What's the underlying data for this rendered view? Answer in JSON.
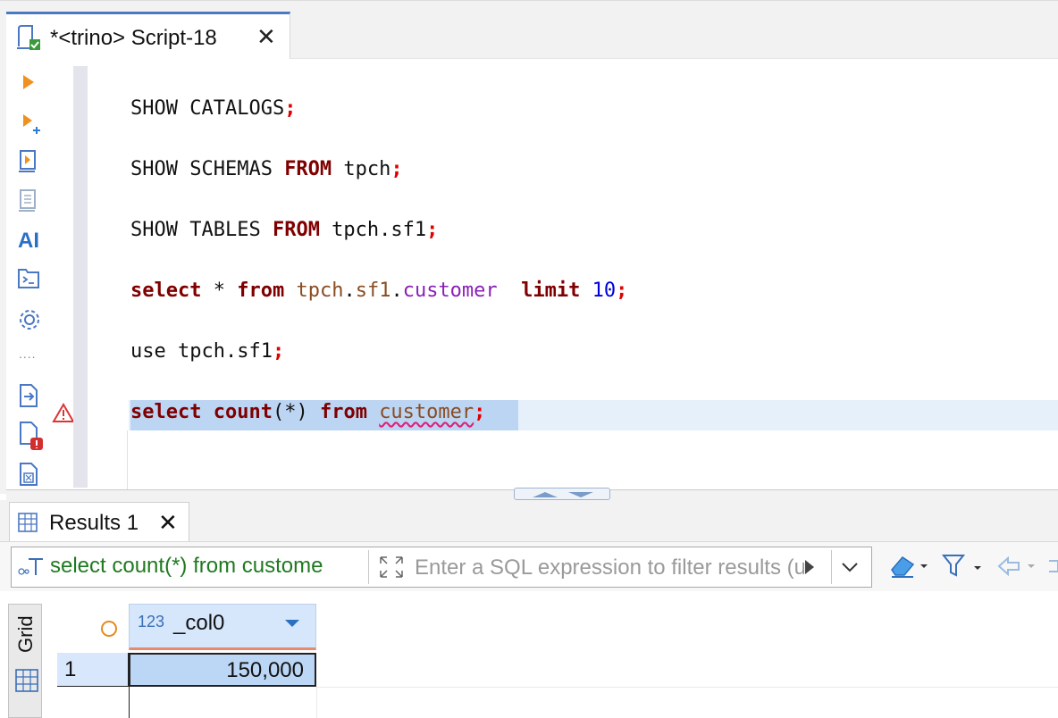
{
  "editor_tab": {
    "title": "*<trino> Script-18",
    "close": "✕"
  },
  "toolbar": {
    "items": [
      "execute-statement",
      "execute-in-new-tab",
      "execute-script",
      "explain-plan",
      "ai-assistant",
      "open-console",
      "settings",
      "more",
      "export",
      "problems",
      "format"
    ],
    "ai_label": "AI",
    "more_label": "...."
  },
  "code_lines": [
    {
      "parts": [
        {
          "t": "SHOW CATALOGS",
          "c": "plain"
        },
        {
          "t": ";",
          "c": "semi"
        }
      ]
    },
    {
      "parts": [
        {
          "t": "SHOW SCHEMAS ",
          "c": "plain"
        },
        {
          "t": "FROM",
          "c": "kw"
        },
        {
          "t": " tpch",
          "c": "plain"
        },
        {
          "t": ";",
          "c": "semi"
        }
      ]
    },
    {
      "parts": [
        {
          "t": "SHOW TABLES ",
          "c": "plain"
        },
        {
          "t": "FROM",
          "c": "kw"
        },
        {
          "t": " tpch.sf1",
          "c": "plain"
        },
        {
          "t": ";",
          "c": "semi"
        }
      ]
    },
    {
      "parts": [
        {
          "t": "select",
          "c": "kw"
        },
        {
          "t": " * ",
          "c": "plain"
        },
        {
          "t": "from",
          "c": "kw"
        },
        {
          "t": " ",
          "c": "plain"
        },
        {
          "t": "tpch",
          "c": "brown"
        },
        {
          "t": ".",
          "c": "plain"
        },
        {
          "t": "sf1",
          "c": "brown"
        },
        {
          "t": ".",
          "c": "plain"
        },
        {
          "t": "customer",
          "c": "purple"
        },
        {
          "t": "  ",
          "c": "plain"
        },
        {
          "t": "limit",
          "c": "kw"
        },
        {
          "t": " ",
          "c": "plain"
        },
        {
          "t": "10",
          "c": "num"
        },
        {
          "t": ";",
          "c": "semi"
        }
      ]
    },
    {
      "parts": [
        {
          "t": "use tpch.sf1",
          "c": "plain"
        },
        {
          "t": ";",
          "c": "semi"
        }
      ]
    },
    {
      "parts": [
        {
          "t": "select",
          "c": "kw"
        },
        {
          "t": " ",
          "c": "plain"
        },
        {
          "t": "count",
          "c": "kw"
        },
        {
          "t": "(*) ",
          "c": "plain"
        },
        {
          "t": "from",
          "c": "kw"
        },
        {
          "t": " ",
          "c": "plain"
        },
        {
          "t": "customer",
          "c": "squiggle brown"
        },
        {
          "t": ";",
          "c": "semi"
        }
      ]
    }
  ],
  "results_tab": {
    "title": "Results 1",
    "close": "✕"
  },
  "filter": {
    "query": "select count(*) from custome",
    "placeholder": "Enter a SQL expression to filter results (use Ctrl+Space)"
  },
  "grid": {
    "side_label": "Grid",
    "columns": [
      {
        "name": "_col0",
        "type": "123"
      }
    ],
    "rows": [
      {
        "num": "1",
        "values": [
          "150,000"
        ]
      }
    ]
  },
  "colors": {
    "accent": "#4a78c2",
    "keyword": "#7f0000",
    "semicolon": "#e00000",
    "selection": "#bcd5f3"
  }
}
